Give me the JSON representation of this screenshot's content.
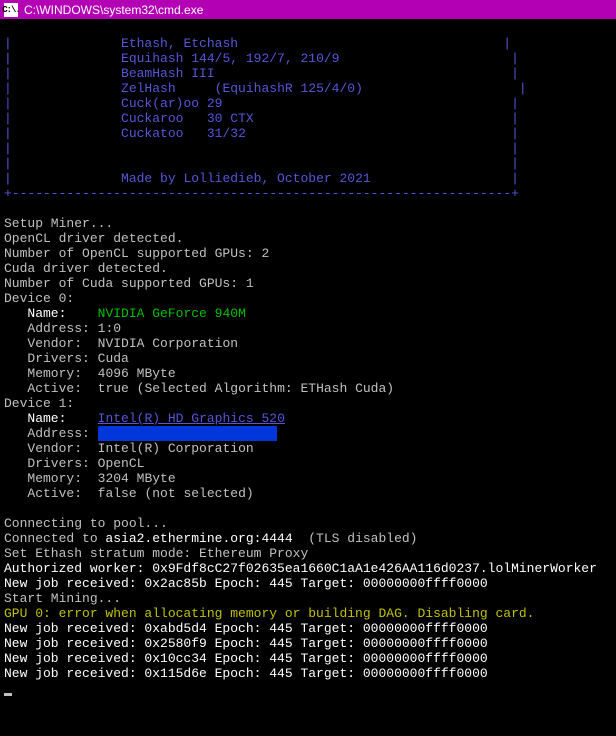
{
  "window": {
    "title": "C:\\WINDOWS\\system32\\cmd.exe",
    "icon_label": "C:\\."
  },
  "banner": {
    "algo1": "Ethash, Etchash",
    "algo2": "Equihash 144/5, 192/7, 210/9",
    "algo3": "BeamHash III",
    "algo4_a": "ZelHash",
    "algo4_b": "(EquihashR 125/4/0)",
    "algo5": "Cuck(ar)oo 29",
    "algo6_a": "Cuckaroo",
    "algo6_b": "30 CTX",
    "algo7_a": "Cuckatoo",
    "algo7_b": "31/32",
    "credit": "Made by Lolliedieb, October 2021",
    "dashline": "+----------------------------------------------------------------+"
  },
  "setup": {
    "l1": "Setup Miner...",
    "l2": "OpenCL driver detected.",
    "l3": "Number of OpenCL supported GPUs: 2",
    "l4": "Cuda driver detected.",
    "l5": "Number of Cuda supported GPUs: 1"
  },
  "dev0": {
    "header": "Device 0:",
    "name_label": "   Name:   ",
    "name_value": "NVIDIA GeForce 940M",
    "addr_label": "   Address:",
    "addr_value": "1:0",
    "vendor_label": "   Vendor: ",
    "vendor_value": "NVIDIA Corporation",
    "drivers_label": "   Drivers:",
    "drivers_value": "Cuda",
    "memory_label": "   Memory: ",
    "memory_value": "4096 MByte",
    "active_label": "   Active: ",
    "active_value": "true (Selected Algorithm: ETHash Cuda)"
  },
  "dev1": {
    "header": "Device 1:",
    "name_label": "   Name:   ",
    "name_value": "Intel(R) HD Graphics 520",
    "addr_label": "   Address:",
    "addr_value_hidden": "                       ",
    "vendor_label": "   Vendor: ",
    "vendor_value": "Intel(R) Corporation",
    "drivers_label": "   Drivers:",
    "drivers_value": "OpenCL",
    "memory_label": "   Memory: ",
    "memory_value": "3204 MByte",
    "active_label": "   Active: ",
    "active_value": "false (not selected)"
  },
  "pool": {
    "l1": "Connecting to pool...",
    "l2_a": "Connected to ",
    "l2_b": "asia2.ethermine.org:4444",
    "l2_c": "  (TLS disabled)",
    "l3": "Set Ethash stratum mode: Ethereum Proxy",
    "l4": "Authorized worker: 0x9Fdf8cC27f02635ea1660C1aA1e426AA116d0237.lolMinerWorker",
    "l5": "New job received: 0x2ac85b Epoch: 445 Target: 00000000ffff0000",
    "l6": "Start Mining...",
    "err": "GPU 0: error when allocating memory or building DAG. Disabling card.",
    "j1": "New job received: 0xabd5d4 Epoch: 445 Target: 00000000ffff0000",
    "j2": "New job received: 0x2580f9 Epoch: 445 Target: 00000000ffff0000",
    "j3": "New job received: 0x10cc34 Epoch: 445 Target: 00000000ffff0000",
    "j4": "New job received: 0x115d6e Epoch: 445 Target: 00000000ffff0000"
  }
}
